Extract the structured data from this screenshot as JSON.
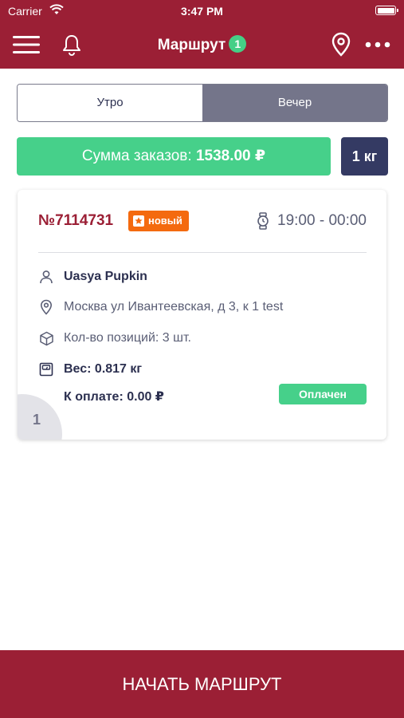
{
  "status_bar": {
    "carrier": "Carrier",
    "time": "3:47 PM"
  },
  "header": {
    "title": "Маршрут",
    "badge_count": "1"
  },
  "segments": {
    "morning": "Утро",
    "evening": "Вечер",
    "selected": "evening"
  },
  "summary": {
    "label": "Сумма заказов:",
    "amount": "1538.00 ₽",
    "weight": "1 кг"
  },
  "order": {
    "number": "№7114731",
    "badge": "новый",
    "time": "19:00 - 00:00",
    "customer": "Uasya Pupkin",
    "address": "Москва ул Ивантеевская, д 3, к 1 test",
    "quantity": "Кол-во позиций: 3 шт.",
    "weight": "Вес: 0.817 кг",
    "to_pay": "К оплате: 0.00 ₽",
    "payment_status": "Оплачен",
    "index": "1"
  },
  "footer": {
    "start_label": "НАЧАТЬ МАРШРУТ"
  },
  "colors": {
    "brand": "#9b1f35",
    "success": "#46d08a",
    "dark": "#343a63",
    "orange": "#f46a0f"
  },
  "icons": [
    "menu-icon",
    "bell-icon",
    "location-icon",
    "more-icon",
    "star-icon",
    "watch-icon",
    "user-icon",
    "pin-icon",
    "box-icon",
    "scale-icon",
    "wifi-icon",
    "battery-icon"
  ]
}
